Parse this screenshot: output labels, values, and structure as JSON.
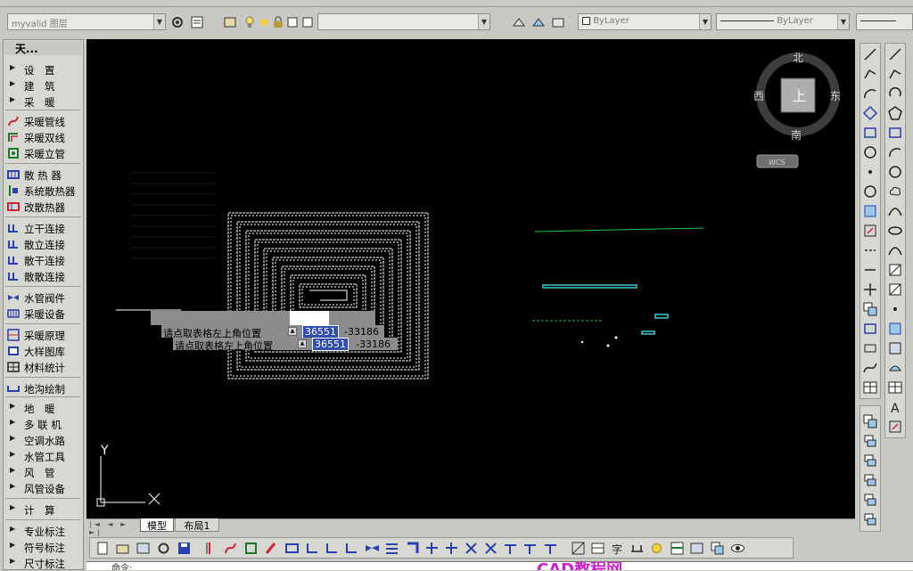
{
  "toolbar": {
    "layer_dropdown": "myvalid 图层",
    "color_dropdown": "ByLayer",
    "linetype_dropdown": "ByLayer"
  },
  "side_menu": {
    "title": "天...",
    "items": [
      {
        "label": "设　置",
        "kind": "folder"
      },
      {
        "label": "建　筑",
        "kind": "folder"
      },
      {
        "label": "采　暖",
        "kind": "folder"
      },
      {
        "label": "采暖管线",
        "kind": "cmd",
        "icon": "heating-pipe-icon"
      },
      {
        "label": "采暖双线",
        "kind": "cmd",
        "icon": "double-line-icon"
      },
      {
        "label": "采暖立管",
        "kind": "cmd",
        "icon": "riser-icon"
      },
      {
        "label": "散 热 器",
        "kind": "cmd",
        "icon": "radiator-icon"
      },
      {
        "label": "系统散热器",
        "kind": "cmd",
        "icon": "system-radiator-icon"
      },
      {
        "label": "改散热器",
        "kind": "cmd",
        "icon": "edit-radiator-icon"
      },
      {
        "label": "立干连接",
        "kind": "cmd",
        "icon": "connect-icon"
      },
      {
        "label": "散立连接",
        "kind": "cmd",
        "icon": "connect-icon"
      },
      {
        "label": "散干连接",
        "kind": "cmd",
        "icon": "connect-icon"
      },
      {
        "label": "散散连接",
        "kind": "cmd",
        "icon": "connect-icon"
      },
      {
        "label": "水管阀件",
        "kind": "cmd",
        "icon": "valve-icon"
      },
      {
        "label": "采暖设备",
        "kind": "cmd",
        "icon": "equipment-icon"
      },
      {
        "label": "采暖原理",
        "kind": "cmd",
        "icon": "schematic-icon"
      },
      {
        "label": "大样图库",
        "kind": "cmd",
        "icon": "library-icon"
      },
      {
        "label": "材料统计",
        "kind": "cmd",
        "icon": "table-icon"
      },
      {
        "label": "地沟绘制",
        "kind": "cmd",
        "icon": "trench-icon"
      },
      {
        "label": "地　暖",
        "kind": "folder"
      },
      {
        "label": "多 联 机",
        "kind": "folder"
      },
      {
        "label": "空调水路",
        "kind": "folder"
      },
      {
        "label": "水管工具",
        "kind": "folder"
      },
      {
        "label": "风　管",
        "kind": "folder"
      },
      {
        "label": "风管设备",
        "kind": "folder"
      },
      {
        "label": "计　算",
        "kind": "folder"
      },
      {
        "label": "专业标注",
        "kind": "folder"
      },
      {
        "label": "符号标注",
        "kind": "folder"
      },
      {
        "label": "尺寸标注",
        "kind": "folder"
      }
    ]
  },
  "viewcube": {
    "north": "北",
    "south": "南",
    "east": "东",
    "west": "西",
    "face": "上",
    "wcs": "WCS"
  },
  "ucs": {
    "x": "X",
    "y": "Y"
  },
  "tabs": {
    "model": "模型",
    "layout1": "布局1"
  },
  "command_prompts": [
    {
      "label": "请点取表格左上角位置",
      "x_value": "36551",
      "y_value": "-33186"
    },
    {
      "label": "请点取表格左上角位置",
      "x_value": "36551",
      "y_value": "-33186"
    }
  ],
  "command_line": {
    "text": "命令:",
    "watermark": "CAD教程网"
  },
  "colors": {
    "canvas": "#000000",
    "chrome": "#c9c9c4",
    "accent_cyan": "#3fc9d6",
    "accent_green": "#22c84a",
    "selection": "#2f4cae"
  }
}
